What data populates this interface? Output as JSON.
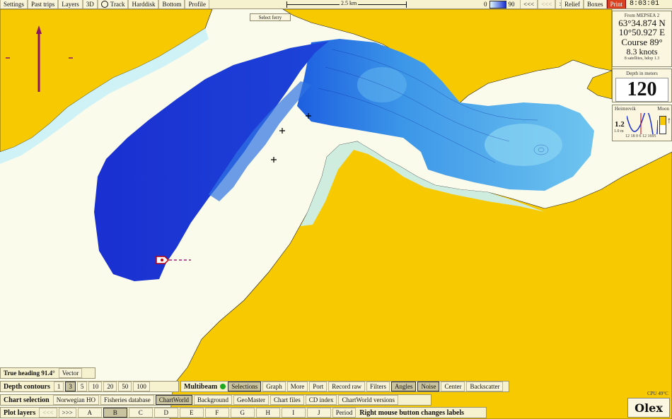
{
  "top_bar": {
    "buttons": [
      "Settings",
      "Past trips",
      "Layers",
      "3D",
      "Track",
      "Harddisk",
      "Bottom",
      "Profile"
    ],
    "scale_label": "2.5 km",
    "depth_scale_min": "0",
    "depth_scale_max": "90",
    "nav_buttons": [
      "<<<",
      "<<<",
      ">>>",
      ">>>"
    ],
    "relief_label": "Relief",
    "boxes_label": "Boxes",
    "print_label": "Print",
    "clock": "8:03:01"
  },
  "map": {
    "select_label": "Select ferry",
    "land_color": "#f7c900",
    "water_color": "#fbfbec",
    "shallow_color": "#c9f1f6"
  },
  "position_panel": {
    "source": "From MEPSEA 2",
    "latitude": "63°34.874 N",
    "longitude": "10°50.927 E",
    "course": "Course 89°",
    "speed": "8.3 knots",
    "satellites": "8 satellites, hdop 1.3"
  },
  "depth_panel": {
    "label": "Depth in meters",
    "value": "120"
  },
  "tide_panel": {
    "label": "Heimrevik",
    "moon_label": "Moon",
    "tide_value": "1.2",
    "axis_left": "1.0 m",
    "axis_ticks": "12 18 0 6 12 1695"
  },
  "heading_panel": {
    "label": "True heading 91.4°",
    "button": "Vector"
  },
  "depth_contours": {
    "label": "Depth contours",
    "options": [
      "1",
      "3",
      "5",
      "10",
      "20",
      "50",
      "100"
    ],
    "selected": "3"
  },
  "multibeam": {
    "label": "Multibeam",
    "buttons": [
      "Selections",
      "Graph",
      "More",
      "Port",
      "Record raw",
      "Filters",
      "Angles",
      "Noise",
      "Center",
      "Backscatter"
    ],
    "selected": [
      "Selections",
      "Angles",
      "Noise"
    ]
  },
  "chart_selection": {
    "label": "Chart selection",
    "buttons": [
      "Norwegian HO",
      "Fisheries database",
      "ChartWorld",
      "Background",
      "GeoMaster",
      "Chart files",
      "CD index",
      "ChartWorld versions"
    ],
    "selected": "ChartWorld"
  },
  "plot_layers": {
    "label": "Plot layers",
    "prev": "<<<",
    "next": ">>>",
    "layers": [
      "A",
      "B",
      "C",
      "D",
      "E",
      "F",
      "G",
      "H",
      "I",
      "J"
    ],
    "selected": "B",
    "period": "Period",
    "hint": "Right mouse button changes labels"
  },
  "temperature": "CPU 49°C",
  "logo": "Olex"
}
